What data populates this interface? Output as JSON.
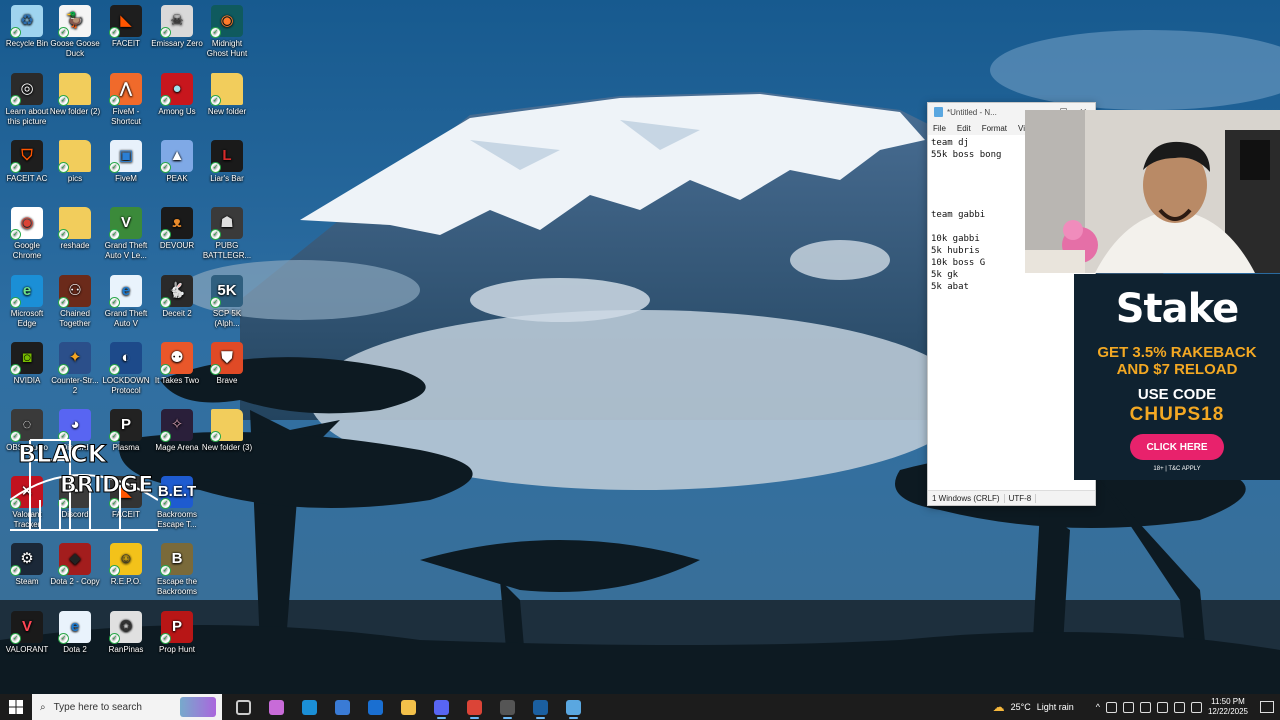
{
  "desktop": {
    "icons": [
      {
        "label": "Recycle Bin",
        "icon": "recycle-bin-icon",
        "color": "#9fd4ef",
        "glyph": "♻",
        "fg": "#2d6fb0"
      },
      {
        "label": "Goose Goose Duck",
        "icon": "goose-icon",
        "color": "#f5f5f5",
        "glyph": "🦆",
        "fg": "#333"
      },
      {
        "label": "FACEIT",
        "icon": "faceit-icon",
        "color": "#1e1e1e",
        "glyph": "◣",
        "fg": "#ff5500"
      },
      {
        "label": "Emissary Zero",
        "icon": "emissary-zero-icon",
        "color": "#d9d9d9",
        "glyph": "☠",
        "fg": "#333"
      },
      {
        "label": "Midnight Ghost Hunt",
        "icon": "ghost-hunt-icon",
        "color": "#0f5a5e",
        "glyph": "◉",
        "fg": "#ff7a2b"
      },
      {
        "label": "Learn about this picture",
        "icon": "camera-icon",
        "color": "#2b2b2b",
        "glyph": "◎",
        "fg": "#fff"
      },
      {
        "label": "New folder (2)",
        "icon": "folder-icon",
        "color": "#f2cd5c",
        "glyph": "",
        "fg": "#fff"
      },
      {
        "label": "FiveM - Shortcut",
        "icon": "fivem-icon",
        "color": "#f06a2b",
        "glyph": "⋀",
        "fg": "#fff"
      },
      {
        "label": "Among Us",
        "icon": "among-us-icon",
        "color": "#c8161d",
        "glyph": "●",
        "fg": "#9fe3f0"
      },
      {
        "label": "New folder",
        "icon": "folder-icon",
        "color": "#f2cd5c",
        "glyph": "",
        "fg": "#fff"
      },
      {
        "label": "FACEIT AC",
        "icon": "faceit-ac-icon",
        "color": "#1e1e1e",
        "glyph": "⛉",
        "fg": "#ff5500"
      },
      {
        "label": "pics",
        "icon": "folder-icon",
        "color": "#f2cd5c",
        "glyph": "",
        "fg": "#fff"
      },
      {
        "label": "FiveM",
        "icon": "fivem-folder-icon",
        "color": "#e8f1fb",
        "glyph": "▣",
        "fg": "#2a7fd4"
      },
      {
        "label": "PEAK",
        "icon": "peak-icon",
        "color": "#7fa9e6",
        "glyph": "▲",
        "fg": "#fff"
      },
      {
        "label": "Liar's Bar",
        "icon": "liars-bar-icon",
        "color": "#1a1a1a",
        "glyph": "L",
        "fg": "#d62b2b"
      },
      {
        "label": "Google Chrome",
        "icon": "chrome-icon",
        "color": "#ffffff",
        "glyph": "◉",
        "fg": "#db4437"
      },
      {
        "label": "reshade",
        "icon": "folder-icon",
        "color": "#f2cd5c",
        "glyph": "",
        "fg": "#fff"
      },
      {
        "label": "Grand Theft Auto V Le...",
        "icon": "gta-icon",
        "color": "#3b8a3a",
        "glyph": "V",
        "fg": "#fff"
      },
      {
        "label": "DEVOUR",
        "icon": "devour-icon",
        "color": "#1a1a1a",
        "glyph": "ᴥ",
        "fg": "#e88a2b"
      },
      {
        "label": "PUBG BATTLEGR...",
        "icon": "pubg-icon",
        "color": "#3a3a3a",
        "glyph": "☗",
        "fg": "#ddd"
      },
      {
        "label": "Microsoft Edge",
        "icon": "edge-icon",
        "color": "#1b8fd6",
        "glyph": "e",
        "fg": "#6ee08a"
      },
      {
        "label": "Chained Together",
        "icon": "chained-together-icon",
        "color": "#6b2a1a",
        "glyph": "⚇",
        "fg": "#fff"
      },
      {
        "label": "Grand Theft Auto V",
        "icon": "ie-icon",
        "color": "#e9f3fc",
        "glyph": "e",
        "fg": "#1e7bd0"
      },
      {
        "label": "Deceit 2",
        "icon": "deceit-icon",
        "color": "#2a2a2a",
        "glyph": "🐇",
        "fg": "#fff"
      },
      {
        "label": "SCP 5K (Alph...",
        "icon": "scp-icon",
        "color": "#2f5f7f",
        "glyph": "5K",
        "fg": "#fff"
      },
      {
        "label": "NVIDIA",
        "icon": "nvidia-icon",
        "color": "#1d1d1d",
        "glyph": "◙",
        "fg": "#76b900"
      },
      {
        "label": "Counter-Str... 2",
        "icon": "cs2-icon",
        "color": "#2b4f8a",
        "glyph": "✦",
        "fg": "#f5a623"
      },
      {
        "label": "LOCKDOWN Protocol",
        "icon": "lockdown-icon",
        "color": "#1d4a8a",
        "glyph": "◐",
        "fg": "#fff"
      },
      {
        "label": "It Takes Two",
        "icon": "it-takes-two-icon",
        "color": "#e9572a",
        "glyph": "⚉",
        "fg": "#fff"
      },
      {
        "label": "Brave",
        "icon": "brave-icon",
        "color": "#e04a26",
        "glyph": "⛊",
        "fg": "#fff"
      },
      {
        "label": "OBS Studio",
        "icon": "obs-icon",
        "color": "#3a3a3a",
        "glyph": "◌",
        "fg": "#fff"
      },
      {
        "label": "Discord",
        "icon": "discord-icon",
        "color": "#5865f2",
        "glyph": "◕",
        "fg": "#fff"
      },
      {
        "label": "Plasma",
        "icon": "plasma-icon",
        "color": "#222",
        "glyph": "P",
        "fg": "#fff"
      },
      {
        "label": "Mage Arena",
        "icon": "mage-arena-icon",
        "color": "#2a1f3a",
        "glyph": "✧",
        "fg": "#c9a"
      },
      {
        "label": "New folder (3)",
        "icon": "folder-icon",
        "color": "#f2cd5c",
        "glyph": "",
        "fg": "#fff"
      },
      {
        "label": "Valorant Tracker",
        "icon": "tracker-icon",
        "color": "#c1121f",
        "glyph": "✕",
        "fg": "#fff"
      },
      {
        "label": "Discord",
        "icon": "discord-alt-icon",
        "color": "#3b3b3b",
        "glyph": "◔",
        "fg": "#fff"
      },
      {
        "label": "FACEIT",
        "icon": "faceit-alt-icon",
        "color": "#333",
        "glyph": "◣",
        "fg": "#ff5500"
      },
      {
        "label": "Backrooms Escape T...",
        "icon": "backrooms-icon",
        "color": "#1e5bd0",
        "glyph": "B.E.T",
        "fg": "#fff"
      },
      {
        "label": "",
        "icon": "blank-icon",
        "color": "transparent",
        "glyph": "",
        "fg": "#fff"
      },
      {
        "label": "Steam",
        "icon": "steam-icon",
        "color": "#1b2838",
        "glyph": "⚙",
        "fg": "#fff"
      },
      {
        "label": "Dota 2 - Copy",
        "icon": "dota-icon",
        "color": "#a31d1d",
        "glyph": "◆",
        "fg": "#222"
      },
      {
        "label": "R.E.P.O.",
        "icon": "repo-icon",
        "color": "#f3c21a",
        "glyph": "☺",
        "fg": "#333"
      },
      {
        "label": "Escape the Backrooms",
        "icon": "escape-backrooms-icon",
        "color": "#7a6a3a",
        "glyph": "B",
        "fg": "#fff"
      },
      {
        "label": "",
        "icon": "blank-icon",
        "color": "transparent",
        "glyph": "",
        "fg": "#fff"
      },
      {
        "label": "VALORANT",
        "icon": "valorant-icon",
        "color": "#1a1a1a",
        "glyph": "V",
        "fg": "#ff4655"
      },
      {
        "label": "Dota 2",
        "icon": "ie-alt-icon",
        "color": "#e9f3fc",
        "glyph": "e",
        "fg": "#1e7bd0"
      },
      {
        "label": "RanPinas",
        "icon": "ranpinas-icon",
        "color": "#e0e0e0",
        "glyph": "✪",
        "fg": "#333"
      },
      {
        "label": "Prop Hunt",
        "icon": "prop-hunt-icon",
        "color": "#b81616",
        "glyph": "P",
        "fg": "#fff"
      }
    ]
  },
  "notepad": {
    "title": "*Untitled - N...",
    "menu": [
      "File",
      "Edit",
      "Format",
      "View"
    ],
    "content": "team dj\n55k boss bong\n\n\n\n\nteam gabbi\n\n10k gabbi\n5k hubris\n10k boss G\n5k gk\n5k abat",
    "status_line": "1 Windows (CRLF)",
    "status_encoding": "UTF-8"
  },
  "ad": {
    "brand": "Stake",
    "line1": "GET 3.5% RAKEBACK",
    "line1b": "AND $7 RELOAD",
    "line2": "USE CODE",
    "code": "CHUPS18",
    "cta": "CLICK HERE",
    "fine": "18+ | T&C APPLY"
  },
  "overlay": {
    "watermark_top": "BLACK",
    "watermark_bottom": "BRIDGE"
  },
  "taskbar": {
    "search_placeholder": "Type here to search",
    "weather_temp": "25°C",
    "weather_desc": "Light rain",
    "time": "11:50 PM",
    "date": "12/22/2025",
    "apps": [
      {
        "name": "task-view-icon",
        "color": "#cccccc"
      },
      {
        "name": "copilot-icon",
        "color": "#c86bd8"
      },
      {
        "name": "edge-taskbar-icon",
        "color": "#1b8fd6"
      },
      {
        "name": "store-icon",
        "color": "#3a7bd5"
      },
      {
        "name": "outlook-icon",
        "color": "#1a6fd1"
      },
      {
        "name": "file-explorer-icon",
        "color": "#f2c04a"
      },
      {
        "name": "discord-taskbar-icon",
        "color": "#5865f2"
      },
      {
        "name": "chrome-taskbar-icon",
        "color": "#db4437"
      },
      {
        "name": "obs-taskbar-icon",
        "color": "#555555"
      },
      {
        "name": "steam-taskbar-icon",
        "color": "#1b5fa0"
      },
      {
        "name": "notepad-taskbar-icon",
        "color": "#5aa7e0"
      }
    ]
  }
}
